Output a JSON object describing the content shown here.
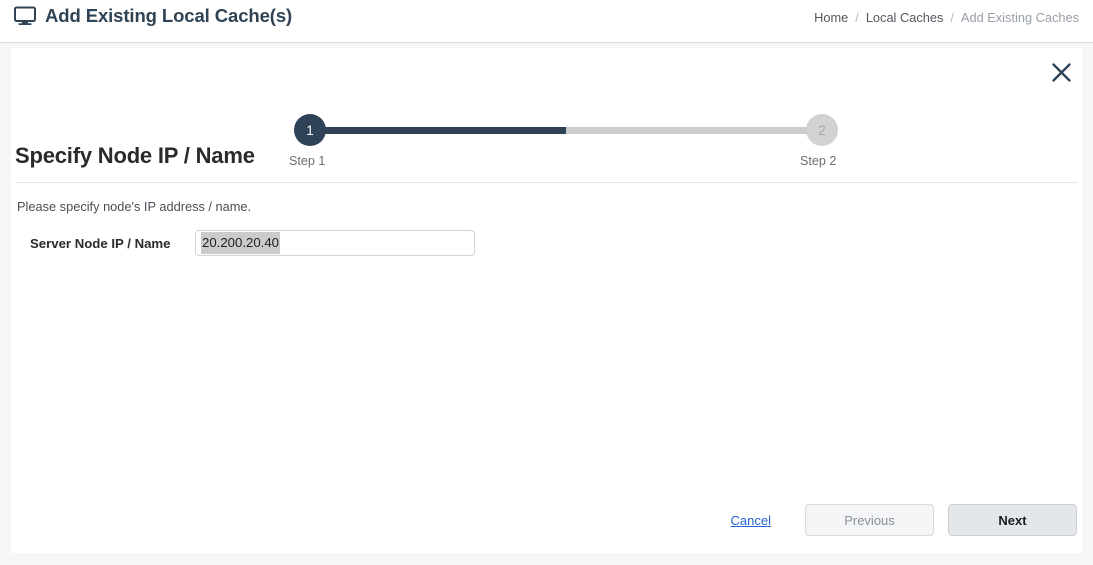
{
  "header": {
    "icon": "monitor-icon",
    "title": "Add Existing Local Cache(s)",
    "breadcrumb": [
      {
        "label": "Home",
        "current": false
      },
      {
        "label": "Local Caches",
        "current": false
      },
      {
        "label": "Add Existing Caches",
        "current": true
      }
    ],
    "separator": "/"
  },
  "panel": {
    "close_icon": "close-icon",
    "stepper": {
      "progress_percent": 50,
      "steps": [
        {
          "number": "1",
          "label": "Step 1",
          "state": "active"
        },
        {
          "number": "2",
          "label": "Step 2",
          "state": "inactive"
        }
      ]
    },
    "section": {
      "heading": "Specify Node IP / Name",
      "instruction": "Please specify node's IP address / name."
    },
    "form": {
      "field_label": "Server Node IP / Name",
      "field_value": "20.200.20.40",
      "field_placeholder": "",
      "field_selected_text": "20.200.20.40"
    },
    "footer": {
      "cancel_label": "Cancel",
      "previous_label": "Previous",
      "next_label": "Next"
    }
  },
  "colors": {
    "accent_dark": "#2f4257",
    "link_blue": "#2464d4",
    "track_gray": "#cccccc",
    "page_bg": "#f6f6f8"
  }
}
